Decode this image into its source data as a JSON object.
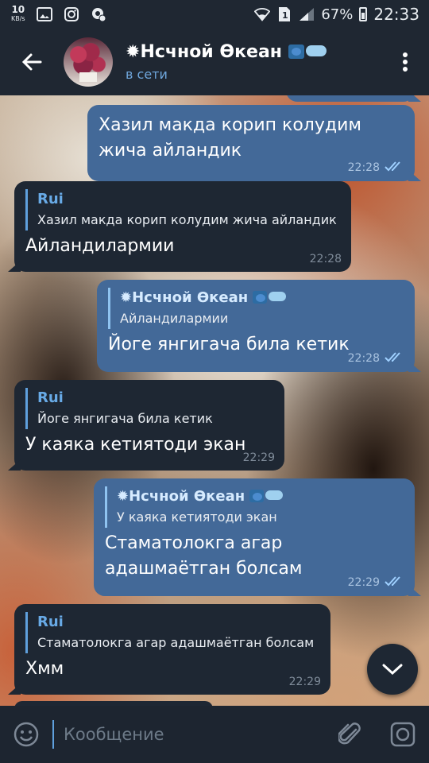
{
  "status_bar": {
    "net_speed": "10",
    "net_unit": "KB/s",
    "battery": "67%",
    "time": "22:33",
    "icons": [
      "gallery-icon",
      "instagram-icon",
      "settings-icon",
      "wifi-icon",
      "sim-icon",
      "signal-icon",
      "battery-icon"
    ]
  },
  "header": {
    "back_icon": "back-arrow-icon",
    "title_prefix": "✹",
    "title": "Нсчной Өкеан",
    "status": "в сети",
    "menu_icon": "more-vert-icon"
  },
  "messages": [
    {
      "direction": "out",
      "text": "Хазил макда корип колудим жича айландик",
      "time": "22:28",
      "read": true
    },
    {
      "direction": "in",
      "reply_name": "Rui",
      "reply_text": "Хазил макда корип колудим жича айландик",
      "text": "Айландилармии",
      "time": "22:28"
    },
    {
      "direction": "out",
      "reply_name_prefix": "✹",
      "reply_name": "Нсчной Өкеан",
      "reply_text": "Айландилармии",
      "text": "Йоге янгигача била кетик",
      "time": "22:28",
      "read": true
    },
    {
      "direction": "in",
      "reply_name": "Rui",
      "reply_text": "Йоге янгигача била кетик",
      "text": "У каяка кетиятоди экан",
      "time": "22:29"
    },
    {
      "direction": "out",
      "reply_name_prefix": "✹",
      "reply_name": "Нсчной Өкеан",
      "reply_text": "У каяка кетиятоди экан",
      "text": "Стаматолокга агар адашмаётган болсам",
      "time": "22:29",
      "read": true
    },
    {
      "direction": "in",
      "reply_name": "Rui",
      "reply_text": "Стаматолокга агар адашмаётган болсам",
      "text": "Хмм",
      "time": "22:29"
    }
  ],
  "input": {
    "placeholder": "Кообщение",
    "emoji_icon": "emoji-icon",
    "attach_icon": "paperclip-icon",
    "camera_icon": "camera-icon"
  },
  "colors": {
    "header_bg": "#1f2732",
    "outgoing_bubble": "#436998",
    "incoming_bubble": "#1e2733",
    "accent": "#6fa7dd"
  }
}
